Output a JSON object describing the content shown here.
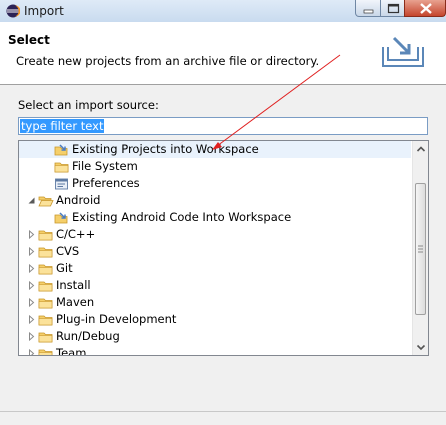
{
  "window": {
    "title": "Import"
  },
  "banner": {
    "heading": "Select",
    "description": "Create new projects from an archive file or directory."
  },
  "source": {
    "label": "Select an import source:",
    "filter_value": "type filter text"
  },
  "tree": {
    "rows": [
      {
        "label": "Existing Projects into Workspace",
        "icon": "projects-icon",
        "level": 2
      },
      {
        "label": "File System",
        "icon": "folder-icon",
        "level": 2
      },
      {
        "label": "Preferences",
        "icon": "preferences-icon",
        "level": 2
      },
      {
        "label": "Android",
        "icon": "folder-open-icon",
        "level": 1,
        "expanded": true
      },
      {
        "label": "Existing Android Code Into Workspace",
        "icon": "projects-icon",
        "level": 2
      },
      {
        "label": "C/C++",
        "icon": "folder-icon",
        "level": 1
      },
      {
        "label": "CVS",
        "icon": "folder-icon",
        "level": 1
      },
      {
        "label": "Git",
        "icon": "folder-icon",
        "level": 1
      },
      {
        "label": "Install",
        "icon": "folder-icon",
        "level": 1
      },
      {
        "label": "Maven",
        "icon": "folder-icon",
        "level": 1
      },
      {
        "label": "Plug-in Development",
        "icon": "folder-icon",
        "level": 1
      },
      {
        "label": "Run/Debug",
        "icon": "folder-icon",
        "level": 1
      },
      {
        "label": "Team",
        "icon": "folder-icon",
        "level": 1
      }
    ]
  },
  "colors": {
    "selection": "#3399ff",
    "annotation_arrow": "#e02020"
  }
}
